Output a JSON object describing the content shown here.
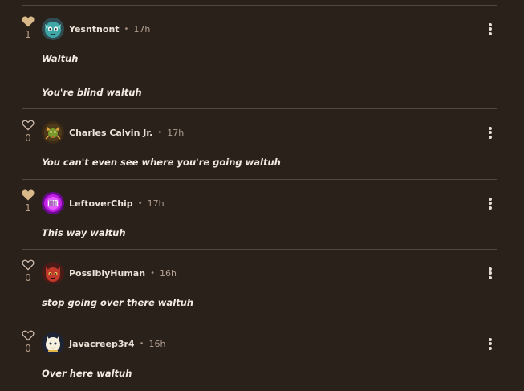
{
  "colors": {
    "background": "#2b211b",
    "divider": "#54473e",
    "liked_heart": "#d9b98a",
    "heart_outline": "#cdbcad"
  },
  "comments": [
    {
      "likes": "1",
      "liked": true,
      "username": "Yesntnont",
      "separator": "•",
      "time": "17h",
      "text_lines": [
        "Waltuh",
        "You're blind waltuh"
      ],
      "avatar": "teal-creature-avatar",
      "menu_icon": "more-vertical-icon"
    },
    {
      "likes": "0",
      "liked": false,
      "username": "Charles Calvin Jr.",
      "separator": "•",
      "time": "17h",
      "text_lines": [
        "You can't even see where you're going waltuh"
      ],
      "avatar": "bird-creature-avatar",
      "menu_icon": "more-vertical-icon"
    },
    {
      "likes": "1",
      "liked": true,
      "username": "LeftoverChip",
      "separator": "•",
      "time": "17h",
      "text_lines": [
        "This way waltuh"
      ],
      "avatar": "purple-face-avatar",
      "menu_icon": "more-vertical-icon"
    },
    {
      "likes": "0",
      "liked": false,
      "username": "PossiblyHuman",
      "separator": "•",
      "time": "16h",
      "text_lines": [
        "stop going over there waltuh"
      ],
      "avatar": "red-cat-avatar",
      "menu_icon": "more-vertical-icon"
    },
    {
      "likes": "0",
      "liked": false,
      "username": "Javacreep3r4",
      "separator": "•",
      "time": "16h",
      "text_lines": [
        "Over here waltuh"
      ],
      "avatar": "white-creature-avatar",
      "menu_icon": "more-vertical-icon"
    }
  ]
}
